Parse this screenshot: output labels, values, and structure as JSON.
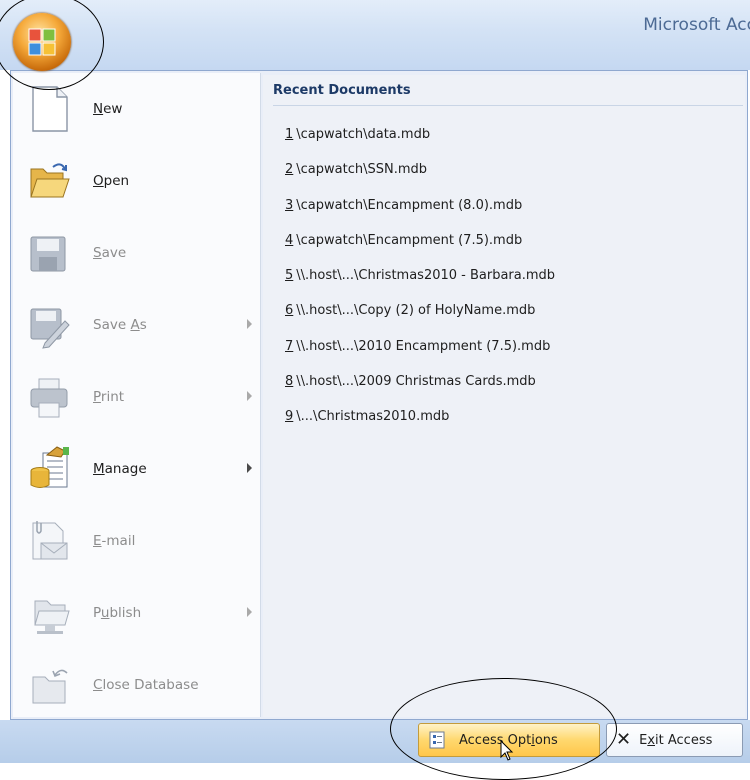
{
  "window": {
    "title": "Microsoft Acc"
  },
  "menu": {
    "items": [
      {
        "pre": "",
        "key": "N",
        "post": "ew",
        "disabled": false,
        "submenu": false,
        "icon": "new-document-icon"
      },
      {
        "pre": "",
        "key": "O",
        "post": "pen",
        "disabled": false,
        "submenu": false,
        "icon": "open-folder-icon"
      },
      {
        "pre": "",
        "key": "S",
        "post": "ave",
        "disabled": true,
        "submenu": false,
        "icon": "save-disk-icon"
      },
      {
        "pre": "Save ",
        "key": "A",
        "post": "s",
        "disabled": true,
        "submenu": true,
        "icon": "save-as-icon"
      },
      {
        "pre": "",
        "key": "P",
        "post": "rint",
        "disabled": true,
        "submenu": true,
        "icon": "printer-icon"
      },
      {
        "pre": "",
        "key": "M",
        "post": "anage",
        "disabled": false,
        "submenu": true,
        "icon": "manage-database-icon"
      },
      {
        "pre": "",
        "key": "E",
        "post": "-mail",
        "disabled": true,
        "submenu": false,
        "icon": "email-icon"
      },
      {
        "pre": "P",
        "key": "u",
        "post": "blish",
        "disabled": true,
        "submenu": true,
        "icon": "publish-icon"
      },
      {
        "pre": "",
        "key": "C",
        "post": "lose Database",
        "disabled": true,
        "submenu": false,
        "icon": "close-database-icon"
      }
    ]
  },
  "recent": {
    "header": "Recent Documents",
    "items": [
      {
        "num": "1",
        "path": "\\capwatch\\data.mdb"
      },
      {
        "num": "2",
        "path": "\\capwatch\\SSN.mdb"
      },
      {
        "num": "3",
        "path": "\\capwatch\\Encampment (8.0).mdb"
      },
      {
        "num": "4",
        "path": "\\capwatch\\Encampment (7.5).mdb"
      },
      {
        "num": "5",
        "path": "\\\\.host\\...\\Christmas2010 - Barbara.mdb"
      },
      {
        "num": "6",
        "path": "\\\\.host\\...\\Copy (2) of HolyName.mdb"
      },
      {
        "num": "7",
        "path": "\\\\.host\\...\\2010 Encampment (7.5).mdb"
      },
      {
        "num": "8",
        "path": "\\\\.host\\...\\2009 Christmas Cards.mdb"
      },
      {
        "num": "9",
        "path": "\\...\\Christmas2010.mdb"
      }
    ]
  },
  "footer": {
    "options": {
      "pre": "Access Opt",
      "key": "i",
      "post": "ons"
    },
    "exit": {
      "pre": "E",
      "key": "x",
      "post": "it Access"
    }
  },
  "colors": {
    "accent": "#ffc64a",
    "disabled_text": "#8c8c8c",
    "header_text": "#1d3a67"
  }
}
